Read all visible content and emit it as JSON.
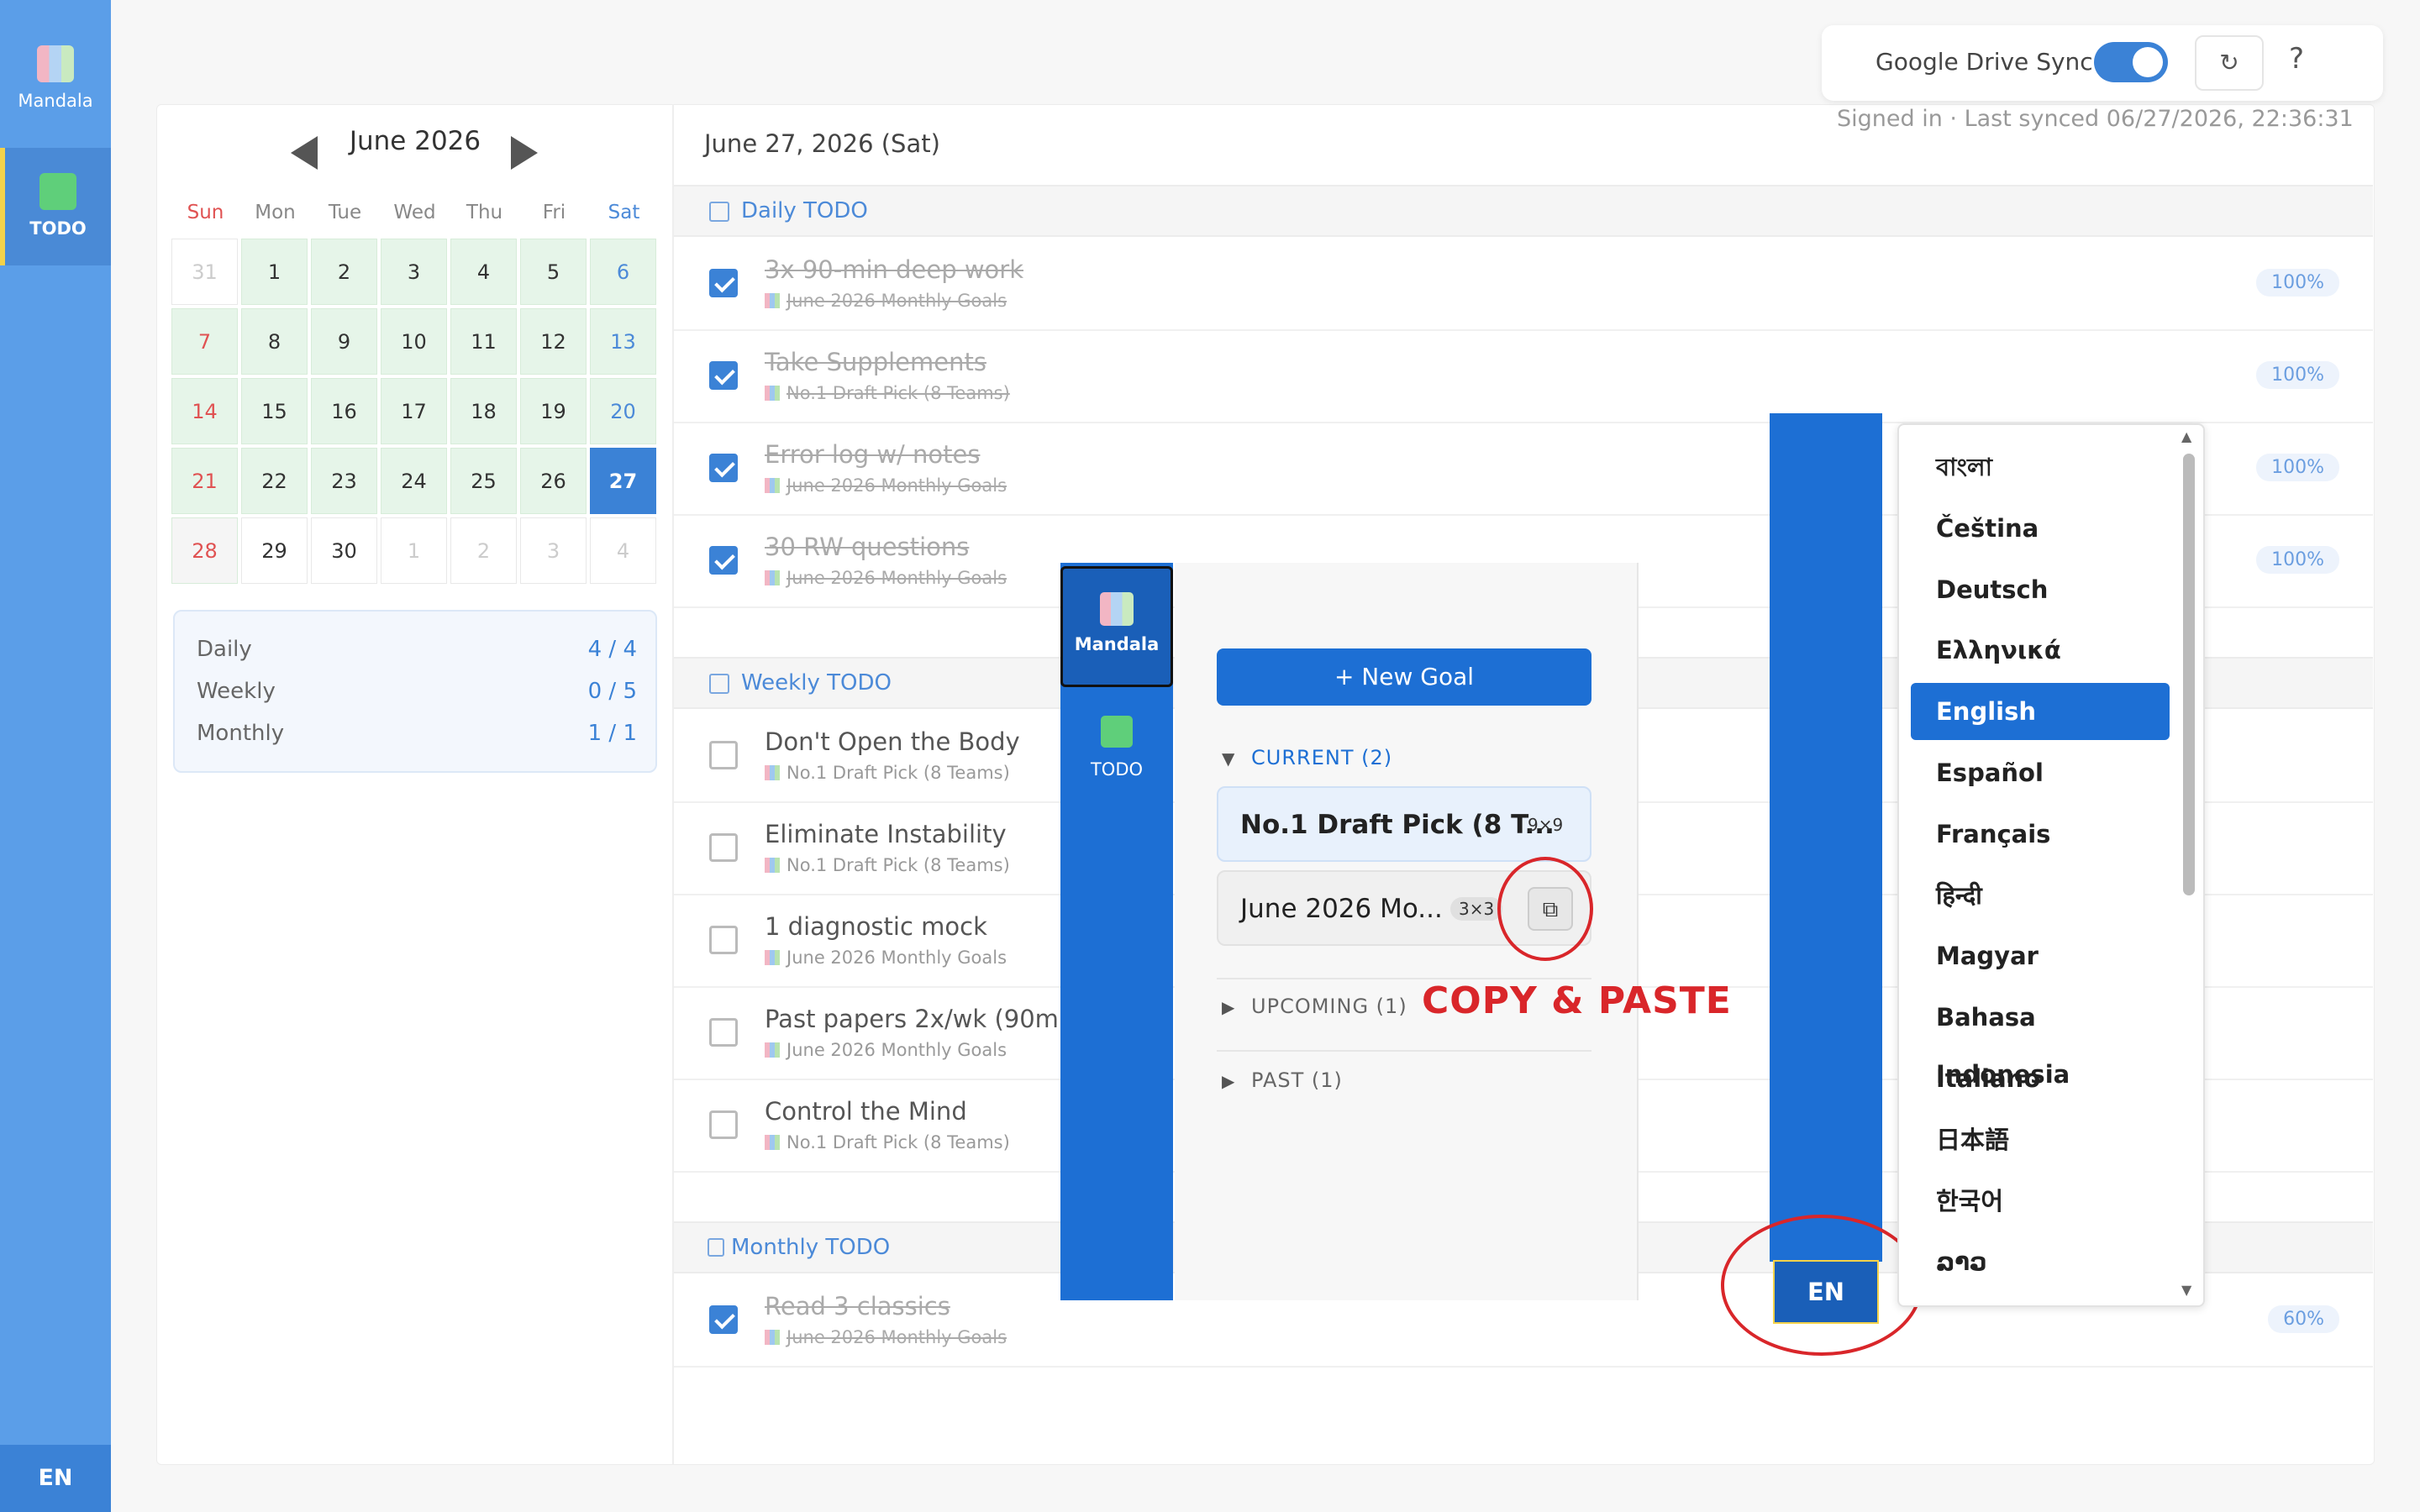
{
  "nav": {
    "items": [
      {
        "label": "Mandala",
        "icon": "mandala-chart-icon"
      },
      {
        "label": "TODO",
        "icon": "checkbox-icon"
      }
    ],
    "language": "EN"
  },
  "calendar": {
    "month_label": "June 2026",
    "weekdays": [
      "Sun",
      "Mon",
      "Tue",
      "Wed",
      "Thu",
      "Fri",
      "Sat"
    ],
    "weeks": [
      [
        "31",
        "1",
        "2",
        "3",
        "4",
        "5",
        "6"
      ],
      [
        "7",
        "8",
        "9",
        "10",
        "11",
        "12",
        "13"
      ],
      [
        "14",
        "15",
        "16",
        "17",
        "18",
        "19",
        "20"
      ],
      [
        "21",
        "22",
        "23",
        "24",
        "25",
        "26",
        "27"
      ],
      [
        "28",
        "29",
        "30",
        "1",
        "2",
        "3",
        "4"
      ]
    ],
    "selected_day": "27"
  },
  "stats": {
    "daily_label": "Daily",
    "daily_value": "4 / 4",
    "weekly_label": "Weekly",
    "weekly_value": "0 / 5",
    "monthly_label": "Monthly",
    "monthly_value": "1 / 1"
  },
  "sync": {
    "label": "Google Drive Sync",
    "enabled": true,
    "refresh_icon": "↻",
    "help_icon": "?",
    "status": "Signed in · Last synced 06/27/2026, 22:36:31"
  },
  "main": {
    "date_heading": "June 27, 2026 (Sat)",
    "daily_title": "Daily TODO",
    "daily": [
      {
        "title": "3x 90-min deep work",
        "goal": "June 2026 Monthly Goals",
        "pct": "100%",
        "done": true
      },
      {
        "title": "Take Supplements",
        "goal": "No.1 Draft Pick (8 Teams)",
        "pct": "100%",
        "done": true
      },
      {
        "title": "Error log w/ notes",
        "goal": "June 2026 Monthly Goals",
        "pct": "100%",
        "done": true
      },
      {
        "title": "30 RW questions",
        "goal": "June 2026 Monthly Goals",
        "pct": "100%",
        "done": true
      }
    ],
    "weekly_title": "Weekly TODO",
    "weekly": [
      {
        "title": "Don't Open the Body",
        "goal": "No.1 Draft Pick (8 Teams)",
        "done": false
      },
      {
        "title": "Eliminate Instability",
        "goal": "No.1 Draft Pick (8 Teams)",
        "done": false
      },
      {
        "title": "1 diagnostic mock",
        "goal": "June 2026 Monthly Goals",
        "done": false
      },
      {
        "title": "Past papers 2x/wk (90m)",
        "goal": "June 2026 Monthly Goals",
        "done": false
      },
      {
        "title": "Control the Mind",
        "goal": "No.1 Draft Pick (8 Teams)",
        "done": false
      }
    ],
    "monthly_title": "Monthly TODO",
    "monthly": [
      {
        "title": "Read 3 classics",
        "goal": "June 2026 Monthly Goals",
        "pct": "60%",
        "done": true
      }
    ]
  },
  "overlay": {
    "side_mandala": "Mandala",
    "side_todo": "TODO",
    "new_goal": "+ New Goal",
    "current_label": "CURRENT (2)",
    "goals": [
      {
        "name": "No.1 Draft Pick (8 T...",
        "size": "9×9"
      },
      {
        "name": "June 2026 Mo...",
        "size": "3×3"
      }
    ],
    "upcoming_label": "UPCOMING (1)",
    "past_label": "PAST (1)",
    "annotation": "COPY & PASTE",
    "accent": "#d9262a"
  },
  "lang_menu": {
    "button": "EN",
    "options": [
      "বাংলা",
      "Čeština",
      "Deutsch",
      "Ελληνικά",
      "English",
      "Español",
      "Français",
      "हिन्दी",
      "Magyar",
      "Bahasa Indonesia",
      "Italiano",
      "日本語",
      "한국어",
      "ລາວ"
    ],
    "selected": "English"
  },
  "colors": {
    "primary": "#3b82d6",
    "nav": "#5b9ee8",
    "weekend_green": "#e6f5e9",
    "sunday": "#e05252"
  }
}
